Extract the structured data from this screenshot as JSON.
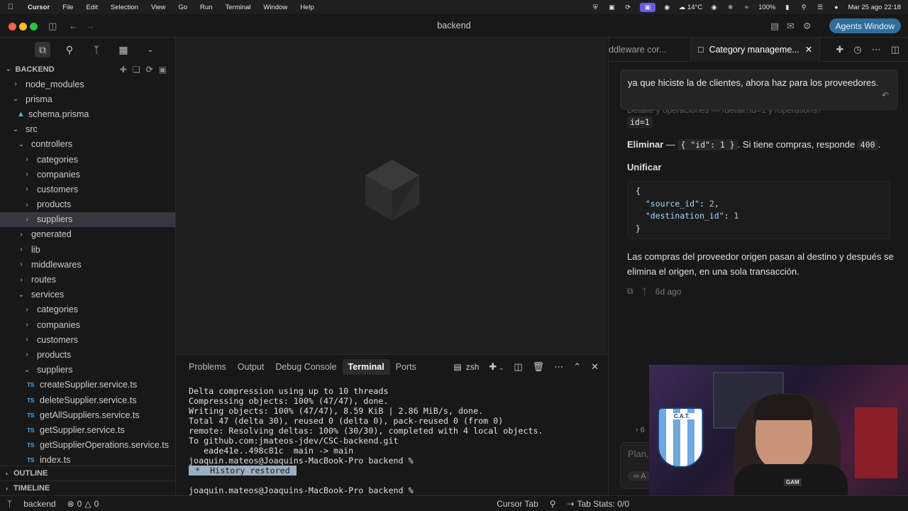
{
  "menubar": {
    "app": "Cursor",
    "items": [
      "File",
      "Edit",
      "Selection",
      "View",
      "Go",
      "Run",
      "Terminal",
      "Window",
      "Help"
    ],
    "weather": "14°C",
    "battery": "100%",
    "datetime": "Mar 25 ago  22:18"
  },
  "window": {
    "title": "backend",
    "agents_button": "Agents Window"
  },
  "explorer": {
    "header": "BACKEND",
    "items": {
      "node_modules": "node_modules",
      "prisma": "prisma",
      "schema": "schema.prisma",
      "src": "src",
      "controllers": "controllers",
      "c_categories": "categories",
      "c_companies": "companies",
      "c_customers": "customers",
      "c_products": "products",
      "c_suppliers": "suppliers",
      "generated": "generated",
      "lib": "lib",
      "middlewares": "middlewares",
      "routes": "routes",
      "services": "services",
      "s_categories": "categories",
      "s_companies": "companies",
      "s_customers": "customers",
      "s_products": "products",
      "s_suppliers": "suppliers",
      "f1": "createSupplier.service.ts",
      "f2": "deleteSupplier.service.ts",
      "f3": "getAllSuppliers.service.ts",
      "f4": "getSupplier.service.ts",
      "f5": "getSupplierOperations.service.ts",
      "f6": "index.ts"
    },
    "ts_badge": "TS",
    "outline": "OUTLINE",
    "timeline": "TIMELINE"
  },
  "panel": {
    "tabs": [
      "Problems",
      "Output",
      "Debug Console",
      "Terminal",
      "Ports"
    ],
    "active_tab": "Terminal",
    "shell": "zsh",
    "lines": [
      "Delta compression using up to 10 threads",
      "Compressing objects: 100% (47/47), done.",
      "Writing objects: 100% (47/47), 8.59 KiB | 2.86 MiB/s, done.",
      "Total 47 (delta 30), reused 0 (delta 0), pack-reused 0 (from 0)",
      "remote: Resolving deltas: 100% (30/30), completed with 4 local objects.",
      "To github.com:jmateos-jdev/CSC-backend.git",
      "   eade41e..498c81c  main -> main",
      "joaquin.mateos@Joaquins-MacBook-Pro backend %"
    ],
    "history_restored": " *  History restored ",
    "prompt": "joaquin.mateos@Joaquins-MacBook-Pro backend %"
  },
  "chat": {
    "tab_prev": "ddleware cor...",
    "tab_active": "Category manageme...",
    "user_message": "ya que hiciste la de clientes, ahora haz para los proveedores.",
    "faded_line": "Detalle y operaciones — /detail?id=1 y /operations?",
    "faded_code": "id=1",
    "delete_label": "Eliminar",
    "delete_dash": " — ",
    "delete_code": "{ \"id\": 1 }",
    "delete_text": ". Si tiene compras, responde ",
    "delete_code2": "400",
    "delete_end": ".",
    "merge_heading": "Unificar",
    "code": {
      "open": "{",
      "k1": "\"source_id\"",
      "v1": "2",
      "k2": "\"destination_id\"",
      "v2": "1",
      "close": "}"
    },
    "summary": "Las compras del proveedor origen pasan al destino y después se elimina el origen, en una sola transacción.",
    "time_ago": "6d ago",
    "collapsed": "6",
    "input_placeholder": "Plan,",
    "input_mode": "A"
  },
  "webcam": {
    "shield_text": "C.A.T.",
    "cup_text": "GAM"
  },
  "statusbar": {
    "branch": "backend",
    "errors": "0",
    "warnings": "0",
    "cursor_tab": "Cursor Tab",
    "tab_stats": "Tab Stats: 0/0"
  }
}
